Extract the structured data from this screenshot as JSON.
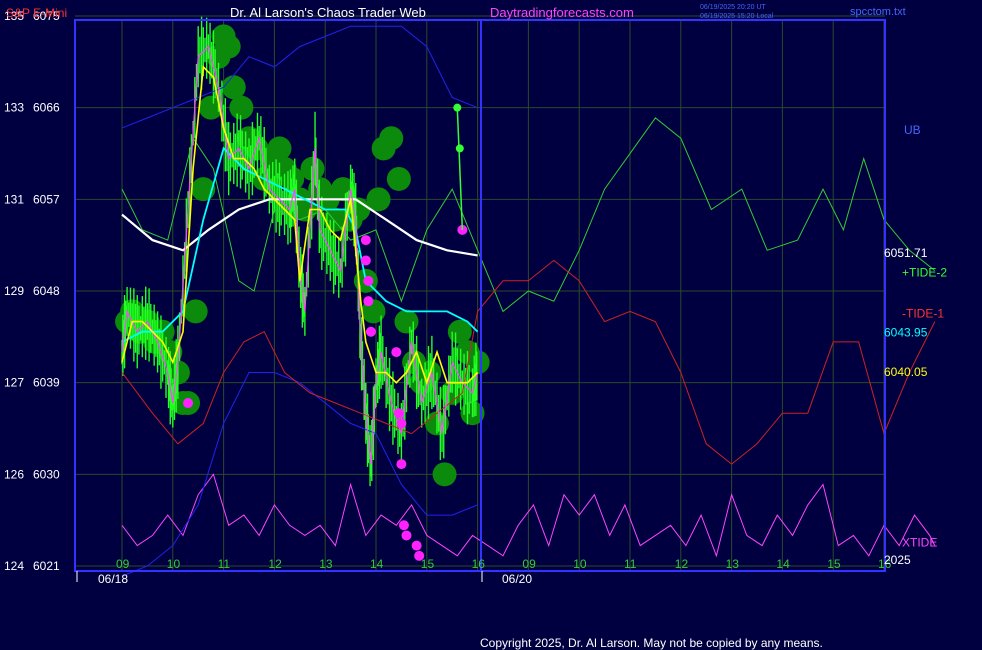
{
  "header": {
    "left_title": "S&P E-Mini",
    "center_title": "Dr. Al Larson's Chaos Trader Web",
    "site": "Daytradingforecasts.com",
    "timestamp_1": "06/19/2025 20:20 UT",
    "timestamp_2": "06/19/2025 15:20 Local",
    "file": "spcctom.txt"
  },
  "footer": {
    "copyright": "Copyright 2025, Dr. Al Larson. May not be copied by any means."
  },
  "colors": {
    "background": "#000040",
    "frame": "#3333ff",
    "grid": "#2a4a2a",
    "price": "#00ff00",
    "price_avg": "#ffff00",
    "sma_fast": "#00ffff",
    "sma_slow": "#ffffff",
    "tide_plus": "#33cc33",
    "tide_minus": "#cc2222",
    "xtide": "#ff44ff",
    "band_lower": "#2222ee",
    "dots": "#ff22ff",
    "label_red": "#ff3333"
  },
  "chart_data": {
    "type": "line",
    "title": "S&P E-Mini",
    "left_axis_labels": [
      {
        "label": "135",
        "price": "6075"
      },
      {
        "label": "133",
        "price": "6066"
      },
      {
        "label": "131",
        "price": "6057"
      },
      {
        "label": "129",
        "price": "6048"
      },
      {
        "label": "127",
        "price": "6039"
      },
      {
        "label": "126",
        "price": "6030"
      },
      {
        "label": "124",
        "price": "6021"
      }
    ],
    "ylim": [
      6021,
      6075
    ],
    "x_tick_labels": [
      "09",
      "10",
      "11",
      "12",
      "13",
      "14",
      "15",
      "16",
      "09",
      "10",
      "11",
      "12",
      "13",
      "14",
      "15",
      "16"
    ],
    "x_dates": [
      "06/18",
      "06/20"
    ],
    "grid": true,
    "right_labels": [
      {
        "text": "UB",
        "value": 6063.8,
        "color": "#4466ff"
      },
      {
        "text": "6051.71",
        "value": 6051.71,
        "color": "#ffffff"
      },
      {
        "text": "+TIDE-2",
        "value": 6049.8,
        "color": "#33ff33"
      },
      {
        "text": "-TIDE-1",
        "value": 6045.8,
        "color": "#ff3333"
      },
      {
        "text": "6043.95",
        "value": 6043.95,
        "color": "#00ffff"
      },
      {
        "text": "6040.05",
        "value": 6040.05,
        "color": "#ffff00"
      },
      {
        "text": "XTIDE",
        "value": 6023.3,
        "color": "#ff44ff"
      },
      {
        "text": "2025",
        "value": 6021.6,
        "color": "#ffffff"
      }
    ],
    "series": [
      {
        "name": "price",
        "color": "#00ff00",
        "x": [
          0,
          0.1,
          0.3,
          0.5,
          0.7,
          0.9,
          1.0,
          1.1,
          1.3,
          1.5,
          1.7,
          1.9,
          2.1,
          2.3,
          2.5,
          2.7,
          2.9,
          3.1,
          3.3,
          3.4,
          3.5,
          3.6,
          3.8,
          3.9,
          4.1,
          4.3,
          4.5,
          4.6,
          4.7,
          4.8,
          4.9,
          5.0,
          5.1,
          5.3,
          5.5,
          5.7,
          5.9,
          6.1,
          6.3,
          6.5,
          6.7,
          6.9,
          7.0
        ],
        "y": [
          6042,
          6046,
          6044,
          6045,
          6043,
          6040,
          6037,
          6041,
          6056,
          6071,
          6072,
          6068,
          6061,
          6062,
          6060,
          6063,
          6058,
          6057,
          6056,
          6058,
          6050,
          6046,
          6062,
          6054,
          6052,
          6050,
          6058,
          6055,
          6043,
          6036,
          6031,
          6039,
          6042,
          6037,
          6034,
          6043,
          6037,
          6040,
          6034,
          6041,
          6039,
          6038,
          6040
        ]
      },
      {
        "name": "price_avg",
        "color": "#ffff00",
        "x": [
          0,
          0.2,
          0.4,
          0.6,
          0.8,
          1.0,
          1.2,
          1.4,
          1.6,
          1.8,
          2.0,
          2.2,
          2.4,
          2.6,
          2.8,
          3.0,
          3.2,
          3.4,
          3.5,
          3.7,
          3.9,
          4.1,
          4.3,
          4.5,
          4.7,
          4.8,
          5.0,
          5.2,
          5.4,
          5.6,
          5.8,
          6.0,
          6.2,
          6.4,
          6.6,
          6.8,
          7.0
        ],
        "y": [
          6041,
          6045,
          6045,
          6044,
          6043,
          6041,
          6044,
          6060,
          6070,
          6069,
          6064,
          6061,
          6061,
          6060,
          6058,
          6057,
          6056,
          6055,
          6049,
          6056,
          6056,
          6054,
          6053,
          6057,
          6047,
          6043,
          6040,
          6040,
          6039,
          6040,
          6042,
          6039,
          6042,
          6039,
          6039,
          6039,
          6040
        ]
      },
      {
        "name": "sma_fast",
        "color": "#00ffff",
        "x": [
          0,
          0.4,
          0.8,
          1.2,
          1.6,
          2.0,
          2.4,
          2.8,
          3.2,
          3.6,
          4.0,
          4.4,
          4.6,
          4.8,
          5.2,
          5.6,
          6.0,
          6.4,
          6.8,
          7.0
        ],
        "y": [
          6043,
          6044,
          6044,
          6046,
          6055,
          6062,
          6060,
          6059,
          6058,
          6057,
          6056,
          6056,
          6054,
          6049,
          6047,
          6046,
          6046,
          6046,
          6045,
          6044
        ]
      },
      {
        "name": "sma_slow",
        "color": "#ffffff",
        "x": [
          0,
          0.6,
          1.2,
          1.7,
          2.3,
          2.9,
          3.5,
          4.0,
          4.6,
          5.2,
          5.8,
          6.4,
          7.0
        ],
        "y": [
          6055.5,
          6053,
          6052,
          6054,
          6056,
          6057,
          6057,
          6057,
          6057,
          6055,
          6053,
          6052,
          6051.5
        ]
      },
      {
        "name": "+TIDE-2",
        "color": "#33cc33",
        "x": [
          0,
          0.4,
          0.9,
          1.4,
          1.8,
          2.3,
          2.6,
          3.0,
          3.5,
          4.0,
          4.5,
          5.0,
          5.5,
          6.0,
          6.5,
          7.0,
          7.5,
          8.0,
          8.5,
          9.0,
          9.5,
          10.5,
          11.0,
          11.6,
          12.2,
          12.7,
          13.3,
          13.8,
          14.2,
          14.6,
          15.0,
          15.5,
          16.0
        ],
        "y": [
          6058,
          6054,
          6053,
          6063,
          6060,
          6049,
          6048,
          6056,
          6055,
          6056,
          6053,
          6054,
          6047,
          6054,
          6058,
          6052,
          6046,
          6048,
          6047,
          6052,
          6058,
          6065,
          6063,
          6056,
          6058,
          6052,
          6053,
          6058,
          6054,
          6061,
          6055,
          6052,
          6050
        ]
      },
      {
        "name": "-TIDE-1",
        "color": "#cc2222",
        "x": [
          0,
          0.6,
          1.1,
          1.6,
          2.0,
          2.4,
          2.8,
          3.2,
          3.7,
          4.2,
          4.7,
          5.2,
          5.7,
          6.2,
          6.7,
          7.0,
          7.5,
          8.0,
          8.5,
          9.0,
          9.5,
          10.0,
          10.5,
          11.0,
          11.5,
          12.0,
          12.5,
          13.0,
          13.5,
          14.0,
          14.5,
          15.0,
          15.5,
          16.0
        ],
        "y": [
          6040,
          6036,
          6033,
          6035,
          6040,
          6043,
          6044,
          6040,
          6038,
          6037,
          6036,
          6035,
          6034,
          6036,
          6038,
          6046,
          6049,
          6049,
          6051,
          6049,
          6045,
          6046,
          6045,
          6040,
          6033,
          6031,
          6033,
          6036,
          6036,
          6043,
          6043,
          6034,
          6040,
          6045
        ]
      },
      {
        "name": "XTIDE",
        "color": "#ff44ff",
        "x": [
          0,
          0.3,
          0.6,
          0.9,
          1.2,
          1.5,
          1.8,
          2.1,
          2.4,
          2.7,
          3.0,
          3.3,
          3.6,
          3.9,
          4.2,
          4.5,
          4.8,
          5.1,
          5.4,
          5.7,
          6.0,
          6.3,
          6.6,
          6.9,
          7.2,
          7.5,
          7.8,
          8.1,
          8.4,
          8.7,
          9.0,
          9.3,
          9.6,
          9.9,
          10.2,
          10.5,
          10.8,
          11.1,
          11.4,
          11.7,
          12.0,
          12.3,
          12.6,
          12.9,
          13.2,
          13.5,
          13.8,
          14.1,
          14.4,
          14.7,
          15.0,
          15.3,
          15.6,
          15.9,
          16.0
        ],
        "y": [
          6025,
          6023,
          6024,
          6026,
          6024,
          6028,
          6030,
          6025,
          6026,
          6024,
          6027,
          6025,
          6024,
          6025,
          6023,
          6029,
          6024,
          6026,
          6025,
          6027,
          6024,
          6023,
          6022,
          6024,
          6023,
          6022,
          6025,
          6027,
          6023,
          6028,
          6026,
          6028,
          6024,
          6027,
          6023,
          6024,
          6025,
          6023,
          6026,
          6022,
          6028,
          6024,
          6023,
          6026,
          6024,
          6027,
          6029,
          6023,
          6024,
          6022,
          6025,
          6023,
          6026,
          6024,
          6023
        ]
      },
      {
        "name": "UB",
        "color": "#2222ee",
        "x": [
          0,
          0.5,
          1.0,
          1.5,
          2.0,
          2.5,
          3.0,
          3.5,
          4.0,
          4.5,
          5.0,
          5.5,
          6.0,
          6.5,
          7.0
        ],
        "y": [
          6064,
          6065,
          6066,
          6067,
          6068,
          6071,
          6070,
          6072,
          6073,
          6074,
          6074,
          6074,
          6072,
          6067,
          6066
        ]
      },
      {
        "name": "LB",
        "color": "#2222ee",
        "x": [
          0,
          0.5,
          1.0,
          1.5,
          2.0,
          2.5,
          3.0,
          3.5,
          4.0,
          4.5,
          5.0,
          5.5,
          6.0,
          6.5,
          7.0
        ],
        "y": [
          6020,
          6021,
          6023,
          6027,
          6035,
          6040,
          6040,
          6039,
          6037,
          6035,
          6034,
          6029,
          6026,
          6026,
          6027
        ]
      }
    ],
    "magenta_points": {
      "x": [
        1.3,
        4.8,
        4.8,
        4.85,
        4.85,
        4.9,
        5.4,
        5.45,
        5.5,
        5.5,
        5.55,
        5.6,
        5.8,
        5.85,
        6.7,
        6.65,
        6.6
      ],
      "y": [
        6037,
        6053,
        6051,
        6049,
        6047,
        6044,
        6042,
        6036,
        6035,
        6031,
        6025,
        6024,
        6023,
        6022,
        6054,
        6062,
        6066
      ]
    },
    "halo_points": {
      "x": [
        0.1,
        0.2,
        0.35,
        0.5,
        0.65,
        0.8,
        0.95,
        1.1,
        1.2,
        1.3,
        1.45,
        1.6,
        1.75,
        1.9,
        2.0,
        2.1,
        2.2,
        2.35,
        2.5,
        2.65,
        2.8,
        2.95,
        3.1,
        3.2,
        3.35,
        3.5,
        3.6,
        3.75,
        3.9,
        4.05,
        4.2,
        4.35,
        4.5,
        4.65,
        4.8,
        4.95,
        5.05,
        5.15,
        5.3,
        5.45,
        5.6,
        5.75,
        5.9,
        6.05,
        6.2,
        6.35,
        6.5,
        6.65,
        6.8,
        6.9,
        7.0
      ],
      "y": [
        6045,
        6046,
        6044,
        6045,
        6043,
        6044,
        6042,
        6040,
        6037,
        6037,
        6046,
        6058,
        6066,
        6071,
        6073,
        6072,
        6068,
        6066,
        6063,
        6062,
        6059,
        6061,
        6062,
        6060,
        6059,
        6057,
        6056,
        6060,
        6058,
        6057,
        6055,
        6058,
        6055,
        6056,
        6049,
        6046,
        6057,
        6062,
        6063,
        6059,
        6045,
        6041,
        6039,
        6040,
        6035,
        6030,
        6038,
        6044,
        6042,
        6036,
        6041
      ]
    }
  }
}
